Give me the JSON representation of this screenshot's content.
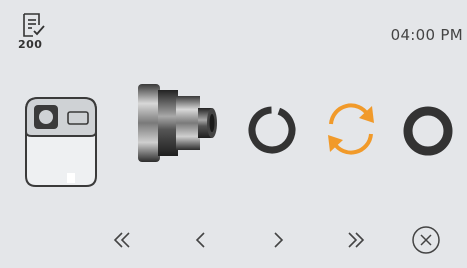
{
  "header": {
    "task_icon": "checklist-icon",
    "task_count": "200",
    "time": "04:00 PM"
  },
  "process_items": [
    {
      "name": "device-housing",
      "icon": "machine-icon"
    },
    {
      "name": "die-mold",
      "icon": "cylinder-die-icon"
    },
    {
      "name": "split-ring",
      "icon": "open-ring-icon"
    },
    {
      "name": "swap-action",
      "icon": "refresh-arrows-icon",
      "color": "#f19a2a"
    },
    {
      "name": "closed-ring",
      "icon": "ring-icon"
    }
  ],
  "navigation": [
    {
      "name": "first-page-button",
      "icon": "double-chevron-left-icon"
    },
    {
      "name": "previous-button",
      "icon": "chevron-left-icon"
    },
    {
      "name": "next-button",
      "icon": "chevron-right-icon"
    },
    {
      "name": "last-page-button",
      "icon": "double-chevron-right-icon"
    },
    {
      "name": "close-button",
      "icon": "close-circle-icon"
    }
  ],
  "colors": {
    "background": "#e4e6e9",
    "accent": "#f19a2a",
    "icon_dark": "#2f2f2f"
  }
}
